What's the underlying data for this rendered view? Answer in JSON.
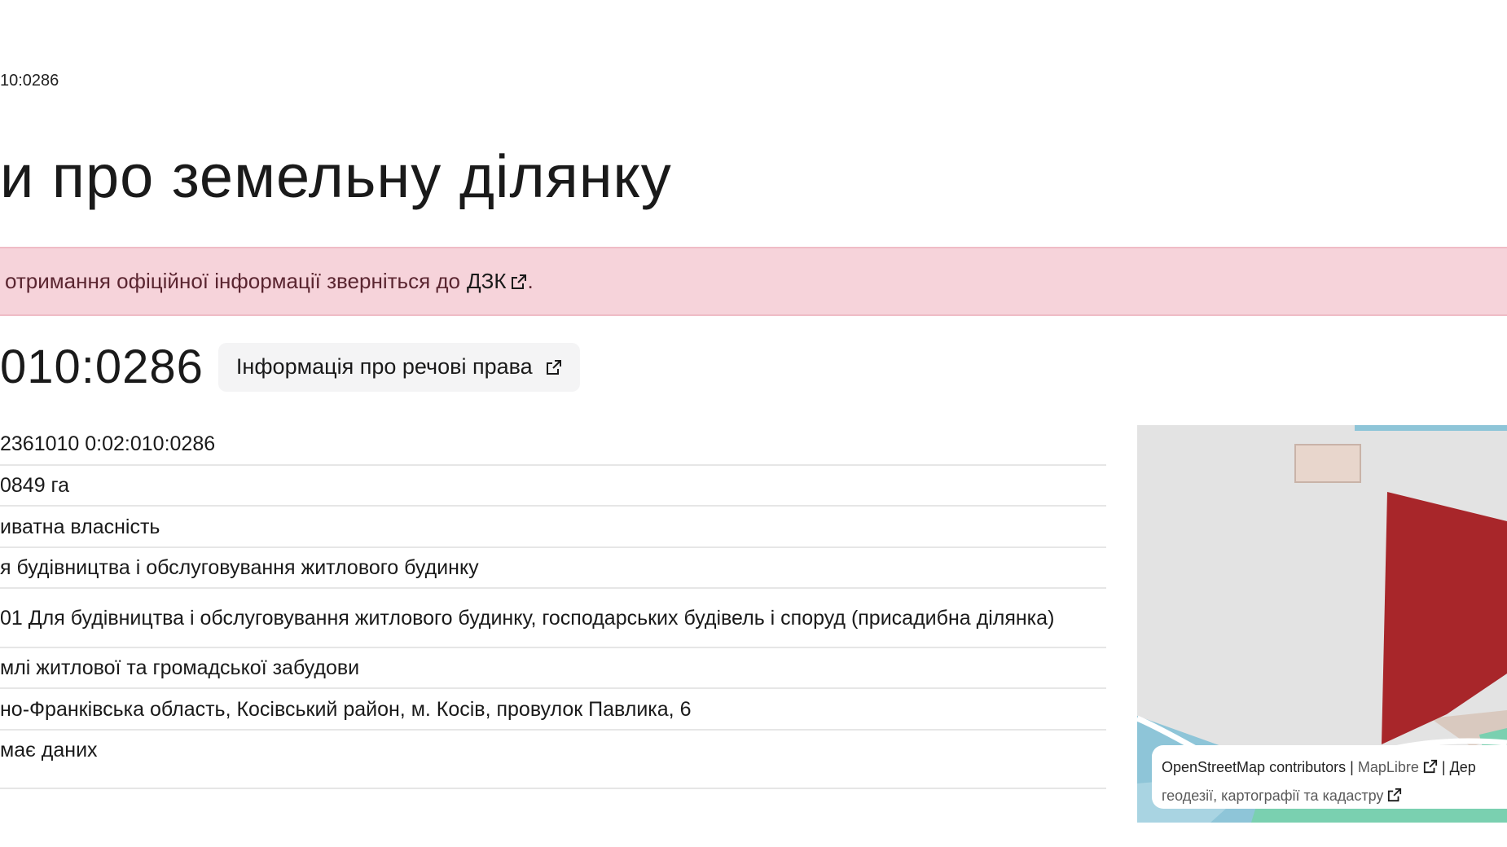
{
  "breadcrumb": {
    "text": "10:0286"
  },
  "page_title": "и про земельну ділянку",
  "alert": {
    "text": "отримання офіційної інформації зверніться до",
    "link_label": "ДЗК",
    "suffix": "."
  },
  "parcel": {
    "cadastral_number": "010:0286",
    "rights_button_label": "Інформація про речові права"
  },
  "details": [
    "2361010 0:02:010:0286",
    "0849 га",
    "иватна власність",
    "я будівництва і обслуговування житлового будинку",
    "01 Для будівництва і обслуговування житлового будинку, господарських будівель і споруд (присадибна ділянка)",
    "млі житлової та громадської забудови",
    "но-Франківська область, Косівський район, м. Косів, провулок Павлика, 6",
    "має даних"
  ],
  "map": {
    "attribution": {
      "osm": "OpenStreetMap contributors",
      "separator1": "|",
      "maplibre": "MapLibre",
      "separator2": "| Дер",
      "line2": "геодезії, картографії та кадастру"
    },
    "colors": {
      "background": "#e3e3e3",
      "parcel": "#a8262a",
      "building": "#e8d6cc",
      "water": "#8ec5d8",
      "green": "#7ad0b0"
    }
  },
  "colors": {
    "alert_bg": "#f6d3da",
    "alert_text": "#5a2530"
  }
}
